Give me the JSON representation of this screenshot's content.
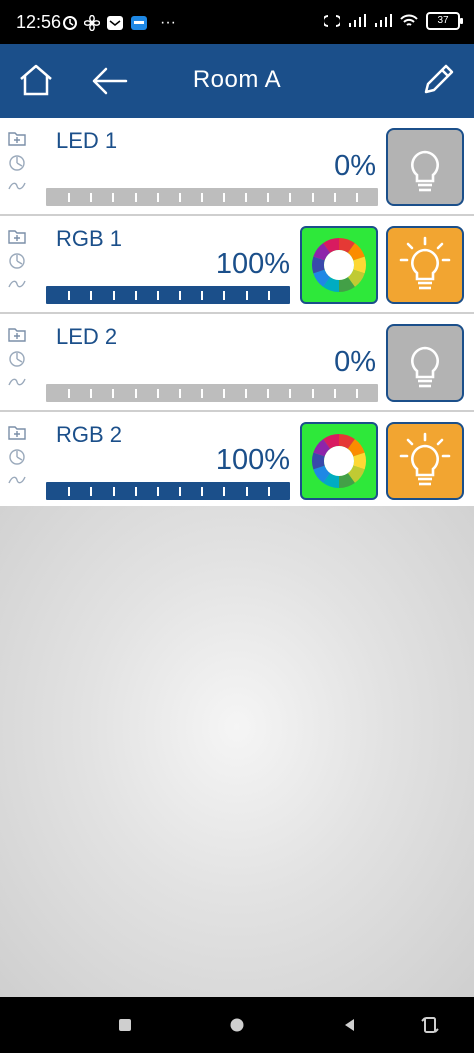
{
  "status_bar": {
    "time": "12:56",
    "battery": "37",
    "icons": [
      "alarm-icon",
      "fan-icon",
      "mail-icon",
      "app-icon",
      "more-icon",
      "vibrate-icon",
      "signal-icon",
      "signal-icon",
      "wifi-icon",
      "battery-icon"
    ],
    "more": "···"
  },
  "header": {
    "title": "Room A",
    "background": "#1b4f8a"
  },
  "devices": [
    {
      "name": "LED 1",
      "level": "0%",
      "level_fraction": 0,
      "type": "led",
      "on": false
    },
    {
      "name": "RGB 1",
      "level": "100%",
      "level_fraction": 1,
      "type": "rgb",
      "on": true
    },
    {
      "name": "LED 2",
      "level": "0%",
      "level_fraction": 0,
      "type": "led",
      "on": false
    },
    {
      "name": "RGB 2",
      "level": "100%",
      "level_fraction": 1,
      "type": "rgb",
      "on": true
    }
  ],
  "colors": {
    "accent": "#1b4f8a",
    "bulb_on": "#f2a531",
    "bulb_off": "#b3b3b3",
    "color_button": "#2ee83a",
    "bar_empty": "#bdbdbd",
    "bar_full": "#1b4f8a"
  },
  "nav": {
    "icons": [
      "recents-square-icon",
      "home-circle-icon",
      "back-triangle-icon",
      "rotate-icon"
    ]
  }
}
